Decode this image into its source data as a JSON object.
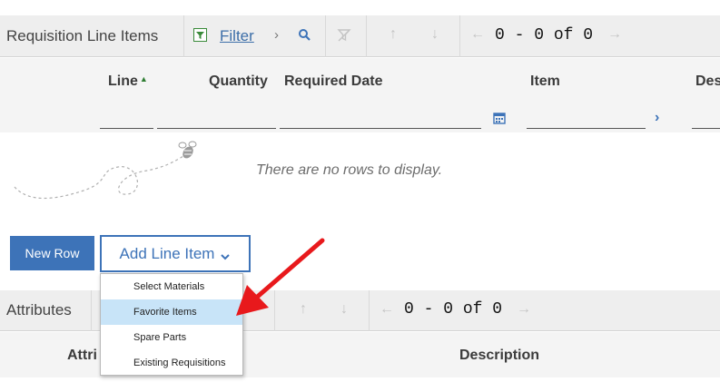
{
  "requisition_section": {
    "title": "Requisition Line Items",
    "filter_label": "Filter",
    "pager": {
      "start": "0",
      "dash": "-",
      "end": "0",
      "of": "of",
      "total": "0"
    }
  },
  "columns": [
    {
      "label": "Line"
    },
    {
      "label": "Quantity"
    },
    {
      "label": "Required Date"
    },
    {
      "label": "Item"
    },
    {
      "label": "Des"
    }
  ],
  "empty_message": "There are no rows to display.",
  "buttons": {
    "new_row": "New Row",
    "add_line_item": "Add Line Item"
  },
  "add_line_item_menu": {
    "items": [
      {
        "label": "Select Materials",
        "highlighted": false
      },
      {
        "label": "Favorite Items",
        "highlighted": true
      },
      {
        "label": "Spare Parts",
        "highlighted": false
      },
      {
        "label": "Existing Requisitions",
        "highlighted": false
      }
    ]
  },
  "attributes_section": {
    "title": "Attributes",
    "pager": {
      "start": "0",
      "dash": "-",
      "end": "0",
      "of": "of",
      "total": "0"
    },
    "columns": [
      {
        "label": "Attri"
      },
      {
        "label": "Description"
      }
    ]
  },
  "colors": {
    "accent": "#3d73b8",
    "sort_arrow": "#2e7d32",
    "menu_highlight": "#c8e4f8",
    "annotation_arrow": "#e8191c"
  },
  "icons": [
    "filter-icon",
    "chevron-right-icon",
    "search-icon",
    "clear-filter-icon",
    "arrow-up-icon",
    "arrow-down-icon",
    "arrow-left-icon",
    "arrow-right-icon",
    "calendar-icon",
    "chevron-down-icon",
    "bee-icon",
    "sort-ascending-icon"
  ]
}
